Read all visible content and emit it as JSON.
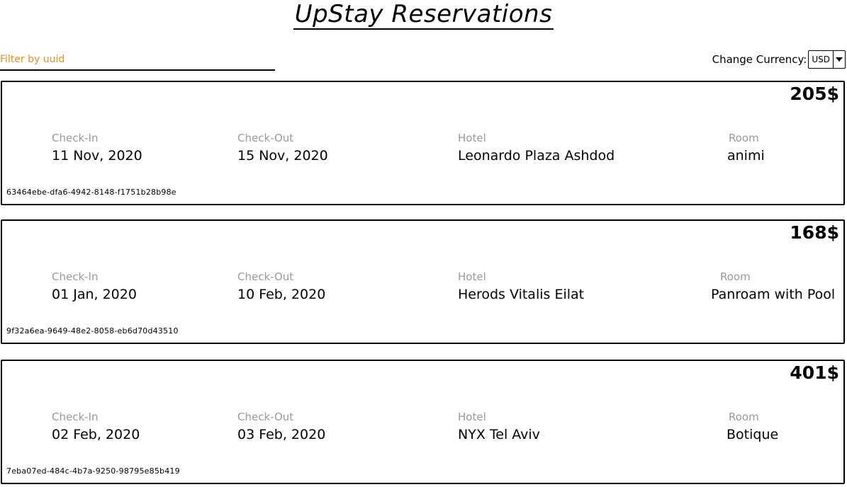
{
  "title": "UpStay Reservations",
  "filter": {
    "placeholder": "Filter by uuid"
  },
  "currency": {
    "label": "Change Currency:",
    "selected": "USD"
  },
  "colors": {
    "filter_placeholder": "#e8902a",
    "field_label": "#9a9a9a",
    "border": "#000000"
  },
  "labels": {
    "check_in": "Check-In",
    "check_out": "Check-Out",
    "hotel": "Hotel",
    "room": "Room"
  },
  "reservations": [
    {
      "price": "205$",
      "check_in": "11 Nov, 2020",
      "check_out": "15 Nov, 2020",
      "hotel": "Leonardo Plaza Ashdod",
      "room": "animi",
      "uuid": "63464ebe-dfa6-4942-8148-f1751b28b98e"
    },
    {
      "price": "168$",
      "check_in": "01 Jan, 2020",
      "check_out": "10 Feb, 2020",
      "hotel": "Herods Vitalis Eilat",
      "room": "Panroam with Pool",
      "uuid": "9f32a6ea-9649-48e2-8058-eb6d70d43510"
    },
    {
      "price": "401$",
      "check_in": "02 Feb, 2020",
      "check_out": "03 Feb, 2020",
      "hotel": "NYX Tel Aviv",
      "room": "Botique",
      "uuid": "7eba07ed-484c-4b7a-9250-98795e85b419"
    }
  ]
}
